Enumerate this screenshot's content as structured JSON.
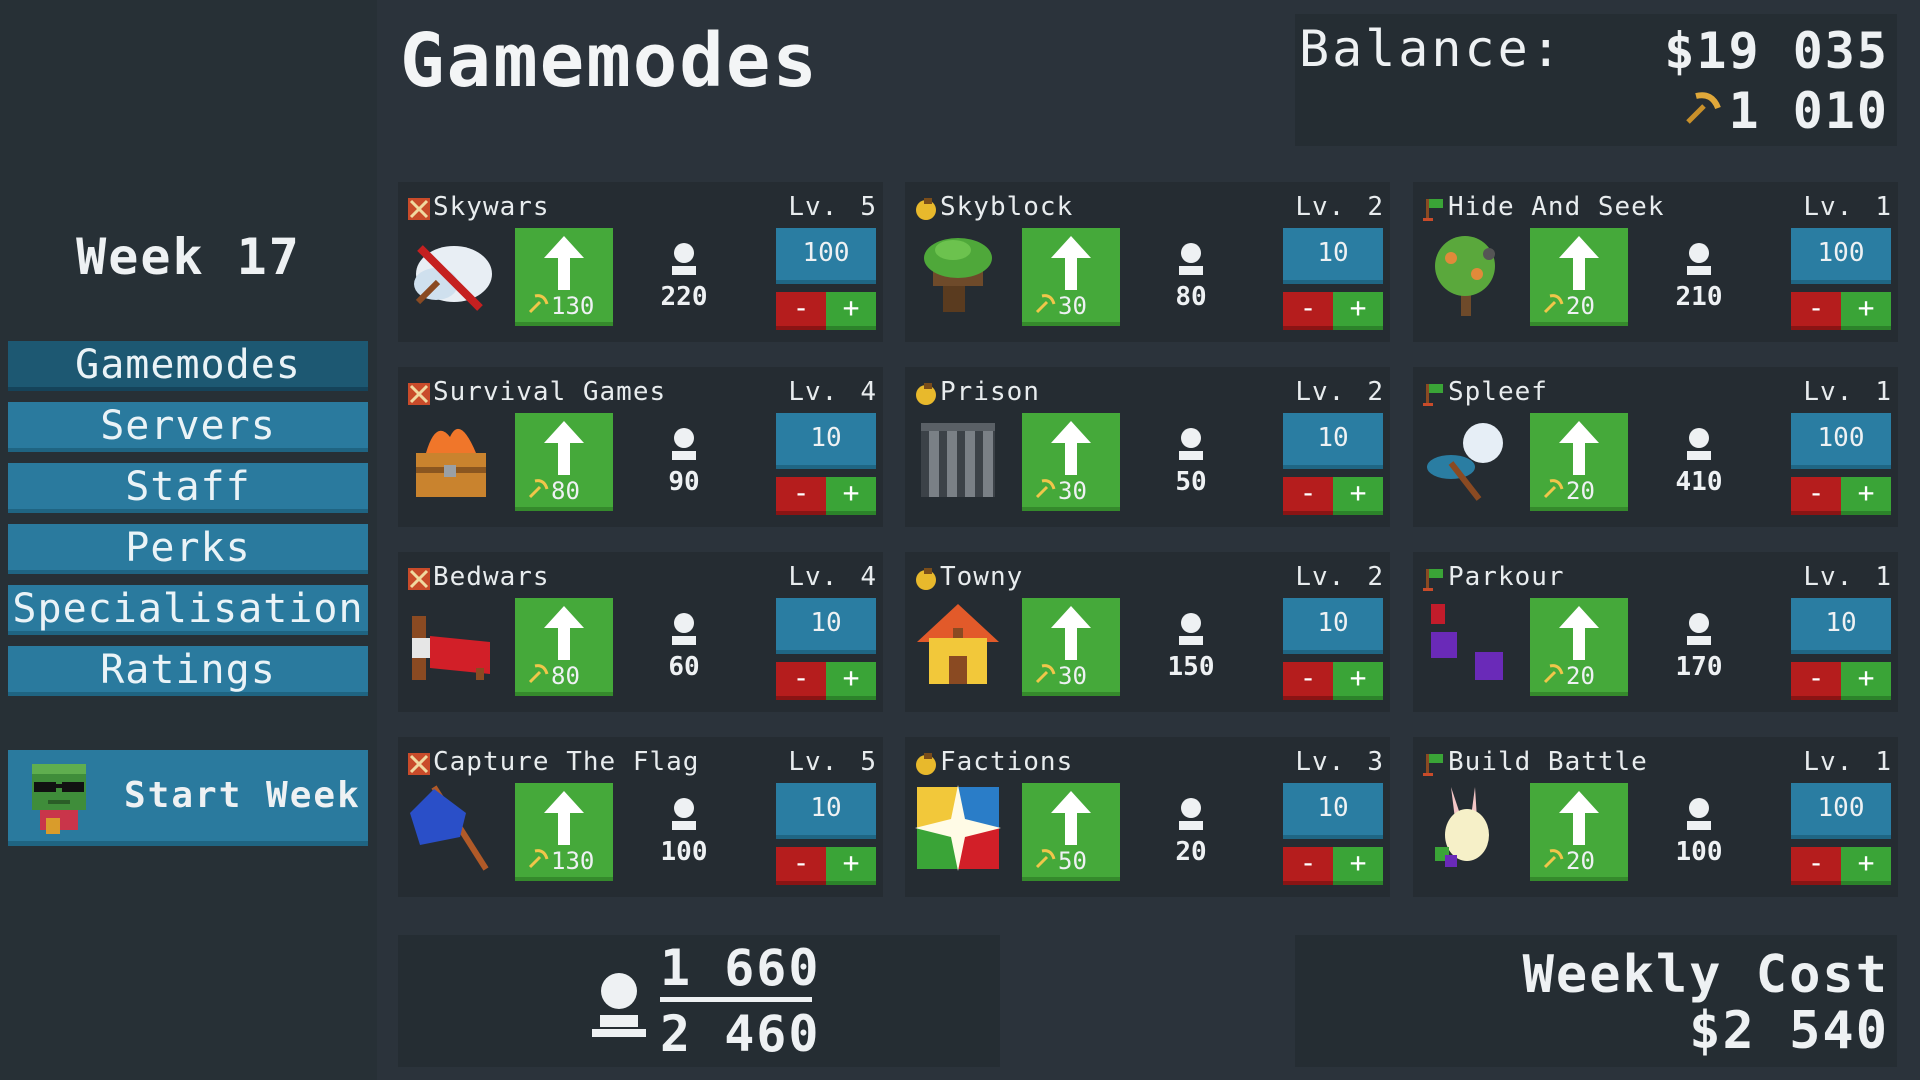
{
  "sidebar": {
    "week_label": "Week 17",
    "nav": [
      "Gamemodes",
      "Servers",
      "Staff",
      "Perks",
      "Specialisation",
      "Ratings"
    ],
    "start_week": "Start Week"
  },
  "header": {
    "title": "Gamemodes",
    "balance_label": "Balance:",
    "balance_money": "$19 035",
    "balance_pickaxe": "1 010"
  },
  "gamemodes": [
    {
      "name": "Skywars",
      "lv_label": "Lv.",
      "level": "5",
      "upgrade_cost": "130",
      "players": "220",
      "price": "100",
      "minus": "-",
      "plus": "+",
      "category_icon": "crossed-swords-icon",
      "art_icon": "cloud-sword-icon"
    },
    {
      "name": "Skyblock",
      "lv_label": "Lv.",
      "level": "2",
      "upgrade_cost": "30",
      "players": "80",
      "price": "10",
      "minus": "-",
      "plus": "+",
      "category_icon": "coin-icon",
      "art_icon": "floating-island-icon"
    },
    {
      "name": "Hide And Seek",
      "lv_label": "Lv.",
      "level": "1",
      "upgrade_cost": "20",
      "players": "210",
      "price": "100",
      "minus": "-",
      "plus": "+",
      "category_icon": "flag-icon",
      "art_icon": "tree-icon"
    },
    {
      "name": "Survival Games",
      "lv_label": "Lv.",
      "level": "4",
      "upgrade_cost": "80",
      "players": "90",
      "price": "10",
      "minus": "-",
      "plus": "+",
      "category_icon": "crossed-swords-icon",
      "art_icon": "burning-chest-icon"
    },
    {
      "name": "Prison",
      "lv_label": "Lv.",
      "level": "2",
      "upgrade_cost": "30",
      "players": "50",
      "price": "10",
      "minus": "-",
      "plus": "+",
      "category_icon": "coin-icon",
      "art_icon": "prison-bars-icon"
    },
    {
      "name": "Spleef",
      "lv_label": "Lv.",
      "level": "1",
      "upgrade_cost": "20",
      "players": "410",
      "price": "100",
      "minus": "-",
      "plus": "+",
      "category_icon": "flag-icon",
      "art_icon": "shovel-snowball-icon"
    },
    {
      "name": "Bedwars",
      "lv_label": "Lv.",
      "level": "4",
      "upgrade_cost": "80",
      "players": "60",
      "price": "10",
      "minus": "-",
      "plus": "+",
      "category_icon": "crossed-swords-icon",
      "art_icon": "red-bed-icon"
    },
    {
      "name": "Towny",
      "lv_label": "Lv.",
      "level": "2",
      "upgrade_cost": "30",
      "players": "150",
      "price": "10",
      "minus": "-",
      "plus": "+",
      "category_icon": "coin-icon",
      "art_icon": "house-icon"
    },
    {
      "name": "Parkour",
      "lv_label": "Lv.",
      "level": "1",
      "upgrade_cost": "20",
      "players": "170",
      "price": "10",
      "minus": "-",
      "plus": "+",
      "category_icon": "flag-icon",
      "art_icon": "parkour-blocks-icon"
    },
    {
      "name": "Capture The Flag",
      "lv_label": "Lv.",
      "level": "5",
      "upgrade_cost": "130",
      "players": "100",
      "price": "10",
      "minus": "-",
      "plus": "+",
      "category_icon": "crossed-swords-icon",
      "art_icon": "blue-flag-icon"
    },
    {
      "name": "Factions",
      "lv_label": "Lv.",
      "level": "3",
      "upgrade_cost": "50",
      "players": "20",
      "price": "10",
      "minus": "-",
      "plus": "+",
      "category_icon": "coin-icon",
      "art_icon": "factions-burst-icon"
    },
    {
      "name": "Build Battle",
      "lv_label": "Lv.",
      "level": "1",
      "upgrade_cost": "20",
      "players": "100",
      "price": "100",
      "minus": "-",
      "plus": "+",
      "category_icon": "flag-icon",
      "art_icon": "rabbit-icon"
    }
  ],
  "totals": {
    "players_current": "1 660",
    "players_capacity": "2 460"
  },
  "weekly_cost": {
    "label": "Weekly Cost",
    "amount": "$2 540"
  },
  "colors": {
    "background": "#2b333b",
    "sidebar": "#273036",
    "panel": "#252c32",
    "nav_button": "#2a7a9e",
    "nav_active": "#1d5872",
    "upgrade_green": "#45a93a",
    "price_blue": "#2a7da2",
    "minus_red": "#b51d1d",
    "plus_green": "#3aa437"
  }
}
